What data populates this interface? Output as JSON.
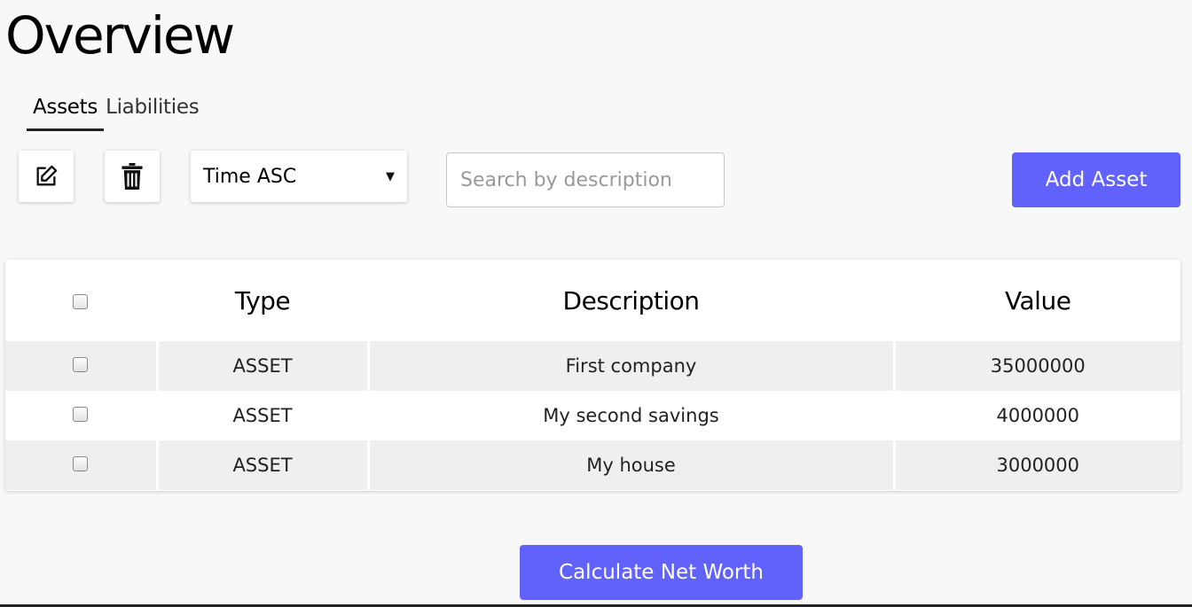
{
  "page": {
    "title": "Overview"
  },
  "tabs": [
    {
      "label": "Assets",
      "active": true
    },
    {
      "label": "Liabilities",
      "active": false
    }
  ],
  "toolbar": {
    "edit_icon": "edit-icon",
    "delete_icon": "trash-icon",
    "sort": {
      "value": "Time ASC"
    },
    "search": {
      "placeholder": "Search by description",
      "value": ""
    },
    "add_label": "Add Asset"
  },
  "table": {
    "headers": {
      "type": "Type",
      "description": "Description",
      "value": "Value"
    },
    "rows": [
      {
        "type": "ASSET",
        "description": "First company",
        "value": "35000000"
      },
      {
        "type": "ASSET",
        "description": "My second savings",
        "value": "4000000"
      },
      {
        "type": "ASSET",
        "description": "My house",
        "value": "3000000"
      }
    ]
  },
  "footer": {
    "calculate_label": "Calculate Net Worth"
  },
  "colors": {
    "primary": "#6161fb",
    "row_shade": "#efefef",
    "background": "#f8f8f8"
  }
}
